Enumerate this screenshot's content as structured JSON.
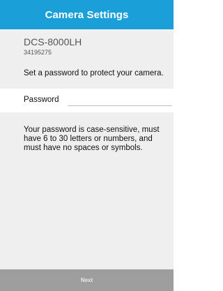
{
  "header": {
    "title": "Camera Settings"
  },
  "device": {
    "name": "DCS-8000LH",
    "id": "34195275"
  },
  "instruction": "Set a password to protect your camera.",
  "password": {
    "label": "Password",
    "value": "",
    "placeholder": ""
  },
  "help_text": "Your password is case-sensitive, must have 6 to 30 letters or numbers, and must have no spaces or symbols.",
  "footer": {
    "next_label": "Next"
  },
  "colors": {
    "header_bg": "#1a9fd9",
    "content_bg": "#efefef",
    "footer_bg": "#9e9e9e"
  }
}
